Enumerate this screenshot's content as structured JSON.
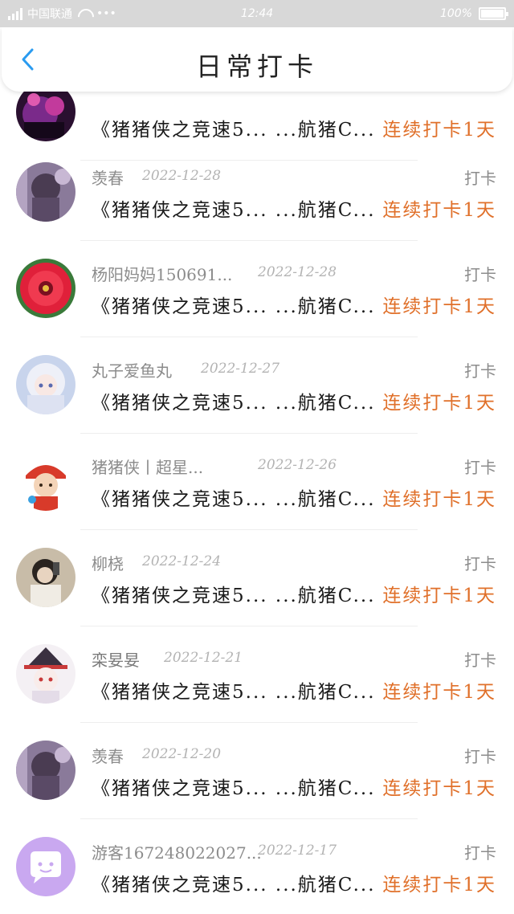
{
  "status_bar": {
    "carrier": "中国联通",
    "dots": "•••",
    "time": "12:44",
    "battery": "100%"
  },
  "header": {
    "title": "日常打卡"
  },
  "colors": {
    "accent_orange": "#e0702a",
    "back_blue": "#2a9bf0"
  },
  "rows": [
    {
      "name": "",
      "date": "",
      "type": "",
      "content": "《猪猪侠之竞速5... ...航猪C...",
      "streak": "连续打卡1天",
      "avatar": "dark-purple-avatar"
    },
    {
      "name": "羡春",
      "date": "2022-12-28",
      "type": "打卡",
      "content": "《猪猪侠之竞速5... ...航猪C...",
      "streak": "连续打卡1天",
      "avatar": "purple-photo-avatar"
    },
    {
      "name": "杨阳妈妈150691...",
      "date": "2022-12-28",
      "type": "打卡",
      "content": "《猪猪侠之竞速5... ...航猪C...",
      "streak": "连续打卡1天",
      "avatar": "red-flower-avatar"
    },
    {
      "name": "丸子爱鱼丸",
      "date": "2022-12-27",
      "type": "打卡",
      "content": "《猪猪侠之竞速5... ...航猪C...",
      "streak": "连续打卡1天",
      "avatar": "anime-white-hair-avatar"
    },
    {
      "name": "猪猪侠丨超星...",
      "date": "2022-12-26",
      "type": "打卡",
      "content": "《猪猪侠之竞速5... ...航猪C...",
      "streak": "连续打卡1天",
      "avatar": "cartoon-red-cap-avatar"
    },
    {
      "name": "柳桡",
      "date": "2022-12-24",
      "type": "打卡",
      "content": "《猪猪侠之竞速5... ...航猪C...",
      "streak": "连续打卡1天",
      "avatar": "selfie-girl-avatar"
    },
    {
      "name": "栾妟妟",
      "date": "2022-12-21",
      "type": "打卡",
      "content": "《猪猪侠之竞速5... ...航猪C...",
      "streak": "连续打卡1天",
      "avatar": "anime-witch-hat-avatar"
    },
    {
      "name": "羡春",
      "date": "2022-12-20",
      "type": "打卡",
      "content": "《猪猪侠之竞速5... ...航猪C...",
      "streak": "连续打卡1天",
      "avatar": "purple-photo-avatar"
    },
    {
      "name": "游客167248022027...",
      "date": "2022-12-17",
      "type": "打卡",
      "content": "《猪猪侠之竞速5... ...航猪C...",
      "streak": "连续打卡1天",
      "avatar": "chat-bubble-avatar"
    }
  ]
}
